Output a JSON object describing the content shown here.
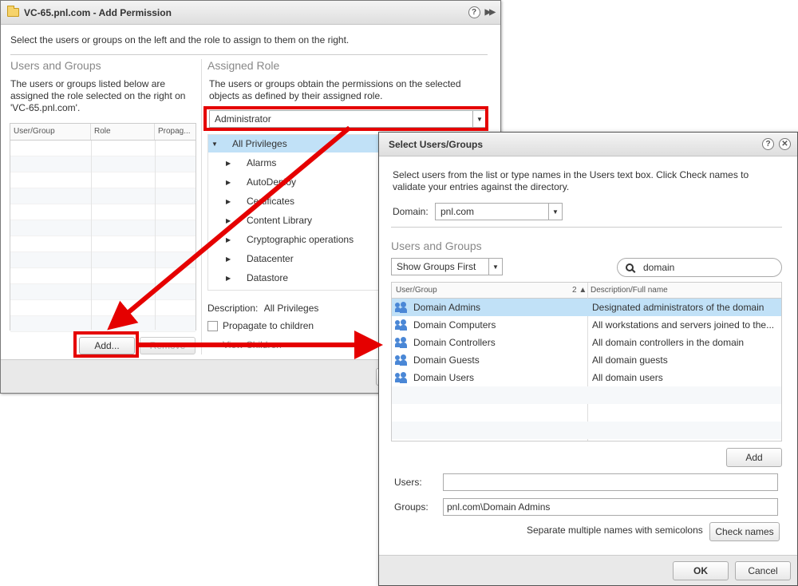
{
  "main_dialog": {
    "title": "VC-65.pnl.com - Add Permission",
    "intro": "Select the users or groups on the left and the role to assign to them on the right.",
    "users_groups": {
      "title": "Users and Groups",
      "desc_line1": "The users or groups listed below are",
      "desc_line2": "assigned the role selected on the right on",
      "desc_line3": "'VC-65.pnl.com'.",
      "columns": [
        "User/Group",
        "Role",
        "Propag..."
      ],
      "add_label": "Add...",
      "remove_label": "Remove"
    },
    "assigned_role": {
      "title": "Assigned Role",
      "desc_line1": "The users or groups obtain the permissions on the selected",
      "desc_line2": "objects as defined by their assigned role.",
      "selected_role": "Administrator",
      "tree_root": "All Privileges",
      "tree_items": [
        "Alarms",
        "AutoDeploy",
        "Certificates",
        "Content Library",
        "Cryptographic operations",
        "Datacenter",
        "Datastore"
      ],
      "description_label": "Description:",
      "description_value": "All Privileges",
      "propagate_label": "Propagate to children",
      "view_children": "View Children"
    }
  },
  "select_dialog": {
    "title": "Select Users/Groups",
    "intro_line1": "Select users from the list or type names in the Users text box. Click Check names to",
    "intro_line2": "validate your entries against the directory.",
    "domain_label": "Domain:",
    "domain_value": "pnl.com",
    "section_title": "Users and Groups",
    "filter_value": "Show Groups First",
    "search_value": "domain",
    "columns": {
      "user_group": "User/Group",
      "sort_indicator": "2 ▲",
      "description": "Description/Full name"
    },
    "rows": [
      {
        "name": "Domain Admins",
        "desc": "Designated administrators of the domain"
      },
      {
        "name": "Domain Computers",
        "desc": "All workstations and servers joined to the..."
      },
      {
        "name": "Domain Controllers",
        "desc": "All domain controllers in the domain"
      },
      {
        "name": "Domain Guests",
        "desc": "All domain guests"
      },
      {
        "name": "Domain Users",
        "desc": "All domain users"
      }
    ],
    "add_label": "Add",
    "users_label": "Users:",
    "users_value": "",
    "groups_label": "Groups:",
    "groups_value": "pnl.com\\Domain Admins",
    "separate_hint": "Separate multiple names with semicolons",
    "check_names_label": "Check names",
    "ok_label": "OK",
    "cancel_label": "Cancel"
  },
  "colors": {
    "highlight": "#e50000",
    "selection": "#c1e1f7",
    "group_icon": "#4a87d6"
  }
}
